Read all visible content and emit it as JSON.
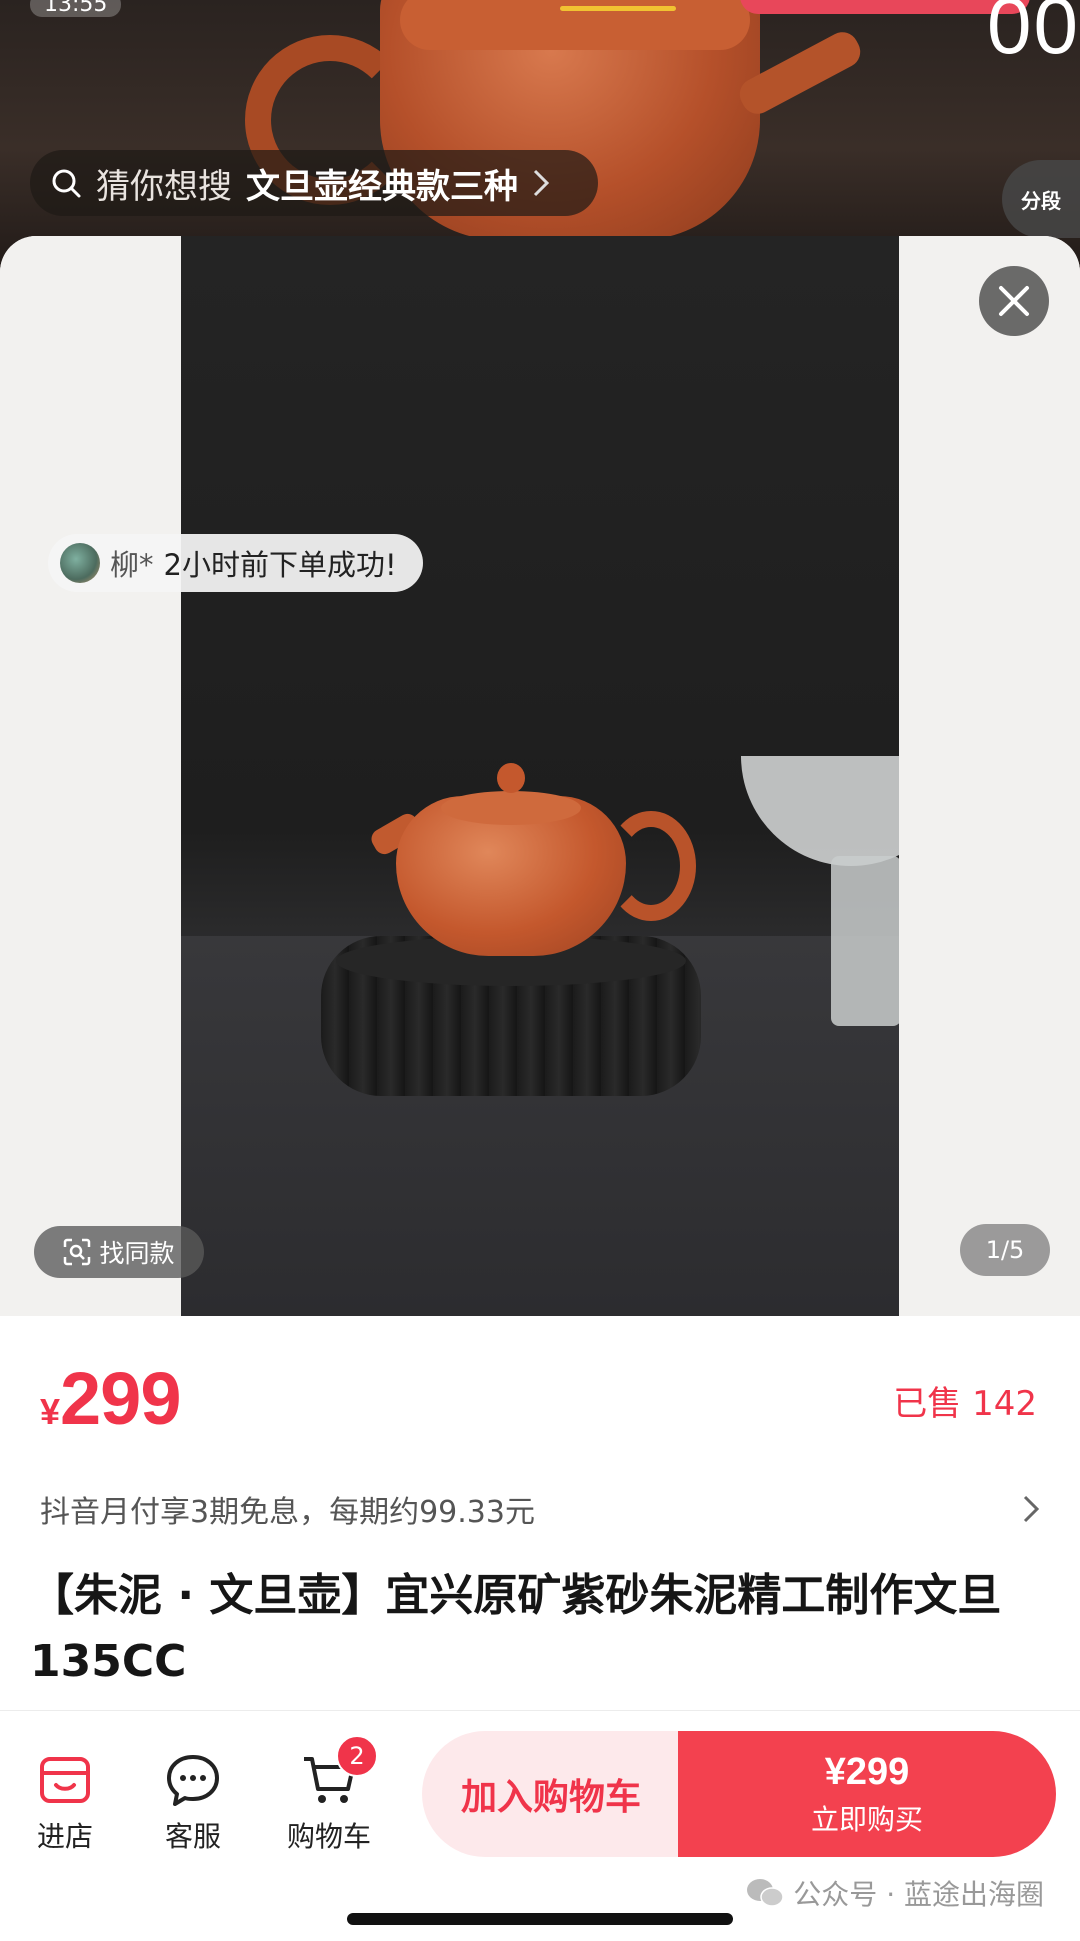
{
  "status_bar": {
    "time": "13:55"
  },
  "background": {
    "digits": "00"
  },
  "search": {
    "prefix": "猜你想搜",
    "query": "文旦壶经典款三种"
  },
  "segment_button": {
    "label": "分段"
  },
  "gallery": {
    "order_toast": {
      "buyer": "柳*",
      "message": "2小时前下单成功!"
    },
    "find_similar_label": "找同款",
    "page_counter": "1/5"
  },
  "product": {
    "currency": "¥",
    "price": "299",
    "sold": "已售 142",
    "installment": "抖音月付享3期免息，每期约99.33元",
    "title": "【朱泥 · 文旦壶】宜兴原矿紫砂朱泥精工制作文旦 135CC"
  },
  "bottom_bar": {
    "store_label": "进店",
    "service_label": "客服",
    "cart_label": "购物车",
    "cart_count": "2",
    "add_to_cart_label": "加入购物车",
    "buy_price": "¥299",
    "buy_label": "立即购买"
  },
  "watermark": {
    "text": "公众号 · 蓝途出海圈"
  },
  "colors": {
    "accent": "#f0344a",
    "accent_light": "#fde9eb"
  }
}
